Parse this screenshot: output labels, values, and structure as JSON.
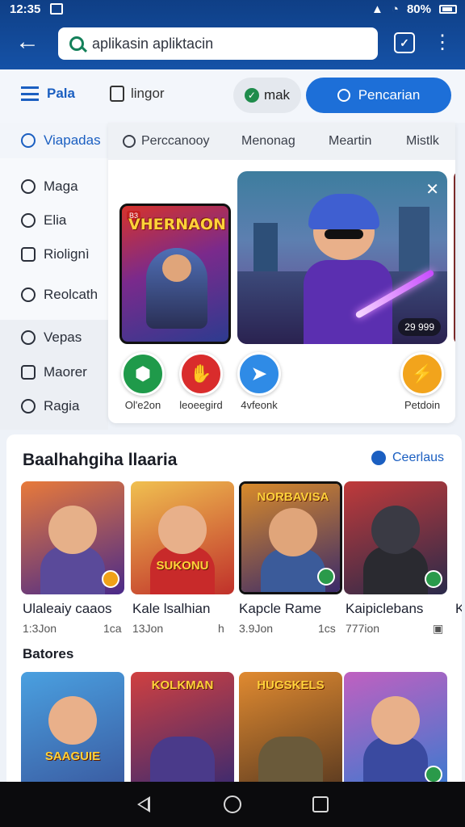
{
  "status": {
    "time": "12:35",
    "battery": "80%"
  },
  "search": {
    "query": "aplikasin apliktacin"
  },
  "actions": {
    "pala": "Pala",
    "lingor": "lingor",
    "mak": "mak",
    "search_btn": "Pencarian"
  },
  "sidebar": {
    "items": [
      {
        "label": "Viapadas",
        "icon": "search-icon"
      },
      {
        "label": "Maga",
        "icon": "heart-icon"
      },
      {
        "label": "Elia",
        "icon": "smile-icon"
      },
      {
        "label": "Riolignì",
        "icon": "calendar-icon"
      },
      {
        "label": "Reolcath",
        "icon": "search-icon"
      },
      {
        "label": "Vepas",
        "icon": "chat-icon"
      },
      {
        "label": "Maorer",
        "icon": "tv-icon"
      },
      {
        "label": "Ragia",
        "icon": "people-icon"
      }
    ]
  },
  "tabs": [
    "Perccanooy",
    "Menonag",
    "Meartin",
    "Mistlk"
  ],
  "featured": {
    "small_logo": "VHERNAON",
    "small_tag": "B3",
    "badge": "29 999"
  },
  "quick_apps": [
    {
      "label": "Ol'e2on",
      "color": "#1f9a4a",
      "icon": "puzzle-icon"
    },
    {
      "label": "leoeegird",
      "color": "#d92c2c",
      "icon": "hand-icon"
    },
    {
      "label": "4vfeonk",
      "color": "#2f8be6",
      "icon": "send-icon"
    },
    {
      "label": "Petdoin",
      "color": "#f2a41c",
      "icon": "bolt-icon"
    }
  ],
  "section": {
    "title": "Baalhahgiha llaaria",
    "link": "Ceerlaus",
    "games": [
      {
        "name": "Ulaleaiy caaos",
        "meta_left": "1:3Jon",
        "meta_right": "1ca"
      },
      {
        "name": "Kale lsalhian",
        "meta_left": "13Jon",
        "meta_right": "h"
      },
      {
        "name": "Kapcle Rame",
        "meta_left": "3.9Jon",
        "meta_right": "1cs"
      },
      {
        "name": "Kaipiclebans",
        "meta_left": "777ion",
        "meta_right": ""
      },
      {
        "name": "K",
        "meta_left": "",
        "meta_right": ""
      }
    ],
    "game_logos": [
      "",
      "SUKONU",
      "NORBAVISA",
      ""
    ],
    "sub_title": "Batores",
    "more_logos": [
      "SAAGUIE",
      "KOLKMAN",
      "HUGSKELS",
      ""
    ]
  }
}
